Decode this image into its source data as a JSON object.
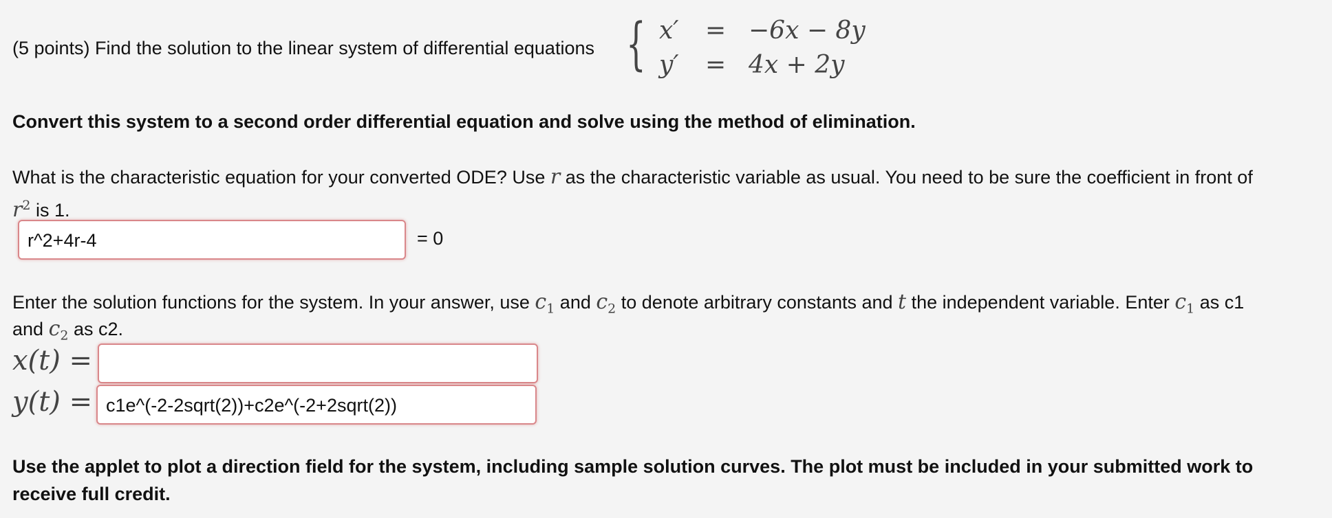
{
  "question": {
    "prefix": "(5 points) Find the solution to the linear system of differential equations",
    "system": {
      "row1": {
        "lhs": "x′",
        "eq": "=",
        "rhs": "−6x − 8y"
      },
      "row2": {
        "lhs": "y′",
        "eq": "=",
        "rhs": "4x + 2y"
      }
    },
    "instruction": "Convert this system to a second order differential equation and solve using the method of elimination."
  },
  "part1": {
    "text_a": "What is the characteristic equation for your converted ODE? Use ",
    "var_r": "r",
    "text_b": " as the characteristic variable as usual. You need to be sure the coefficient in front of",
    "r2": "r",
    "sup2": "2",
    "text_c": " is 1.",
    "answer": "r^2+4r-4",
    "suffix": "= 0"
  },
  "part2": {
    "t1": "Enter the solution functions for the system. In your answer, use ",
    "c1": "c",
    "sub1": "1",
    "t2": " and ",
    "c2": "c",
    "sub2": "2",
    "t3": " to denote arbitrary constants and ",
    "tvar": "t",
    "t4": " the independent variable. Enter ",
    "c1b": "c",
    "sub1b": "1",
    "t5": " as c1",
    "t6": "and ",
    "c2b": "c",
    "sub2b": "2",
    "t7": " as c2.",
    "x_label": "x(t) =",
    "x_value": "",
    "y_label": "y(t) =",
    "y_value": "c1e^(-2-2sqrt(2))+c2e^(-2+2sqrt(2))"
  },
  "footer": {
    "line1": "Use the applet to plot a direction field for the system, including sample solution curves. The plot must be included in your submitted work to",
    "line2": "receive full credit."
  }
}
